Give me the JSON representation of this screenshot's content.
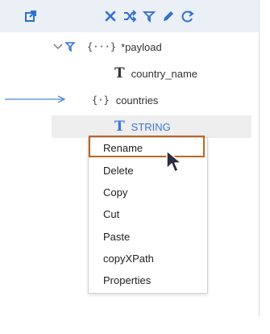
{
  "toolbar": {
    "icons": [
      "open-external-icon",
      "close-icon",
      "shuffle-icon",
      "filter-icon",
      "pencil-icon",
      "refresh-icon"
    ]
  },
  "tree": {
    "payload_label": "*payload",
    "payload_type": "{···}",
    "country_name_type": "T",
    "country_name_label": "country_name",
    "countries_type": "{·}",
    "countries_label": "countries",
    "string_type": "T",
    "string_label": "STRING"
  },
  "context_menu": {
    "items": [
      "Rename",
      "Delete",
      "Copy",
      "Cut",
      "Paste",
      "copyXPath",
      "Properties"
    ]
  },
  "colors": {
    "toolbar_bg": "#ebeff6",
    "accent_blue": "#3b78d8",
    "highlight_orange": "#c0631f"
  }
}
